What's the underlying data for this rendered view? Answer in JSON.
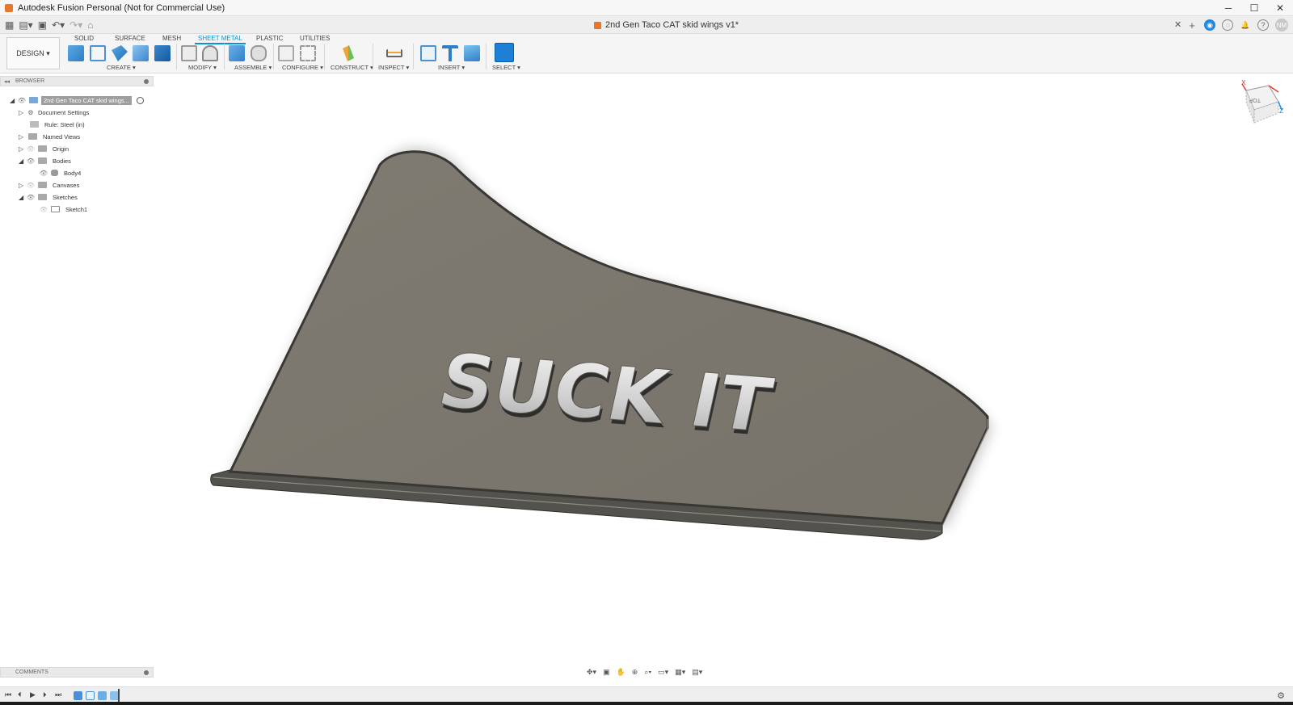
{
  "window": {
    "title": "Autodesk Fusion Personal (Not for Commercial Use)",
    "controls": [
      "─",
      "☐",
      "✕"
    ]
  },
  "document": {
    "tab_title": "2nd Gen Taco CAT skid wings v1*",
    "close": "✕",
    "user_initials": "NM"
  },
  "workspace": {
    "label": "DESIGN ▾"
  },
  "tabs": [
    "SOLID",
    "SURFACE",
    "MESH",
    "SHEET METAL",
    "PLASTIC",
    "UTILITIES"
  ],
  "active_tab": "SHEET METAL",
  "groups": [
    "CREATE ▾",
    "MODIFY ▾",
    "ASSEMBLE ▾",
    "CONFIGURE ▾",
    "CONSTRUCT ▾",
    "INSPECT ▾",
    "INSERT ▾",
    "SELECT ▾"
  ],
  "browser": {
    "title": "BROWSER",
    "root": "2nd Gen Taco CAT skid wings...",
    "items": [
      "Document Settings",
      "Rule: Steel (in)",
      "Named Views",
      "Origin",
      "Bodies",
      "Body4",
      "Canvases",
      "Sketches",
      "Sketch1"
    ]
  },
  "comments": {
    "title": "COMMENTS"
  },
  "model": {
    "engraved_text": "SUCK IT"
  },
  "viewcube": {
    "face_label": "TOP",
    "axis_x": "X",
    "axis_z": "Z"
  },
  "colors": {
    "accent": "#0696d7",
    "plate": "#7c786f",
    "plate_edge": "#3e3c38",
    "brand_orange": "#e8762c"
  }
}
